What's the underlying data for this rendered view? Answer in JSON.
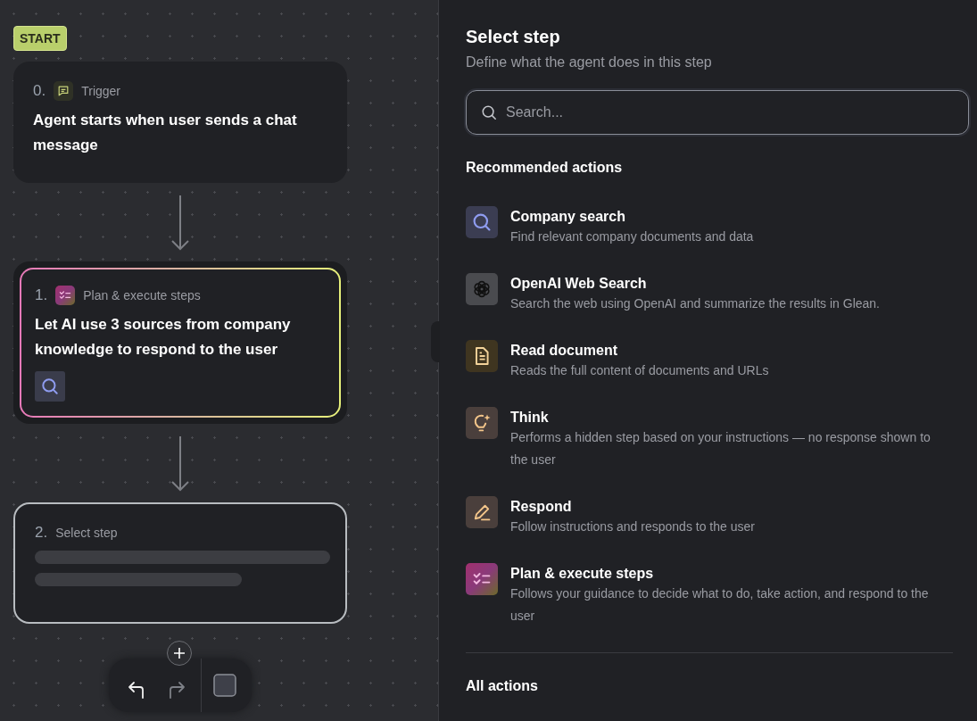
{
  "start_badge": "START",
  "steps": [
    {
      "number": "0.",
      "kind": "trigger",
      "label": "Trigger",
      "text": "Agent starts when user sends a chat message",
      "highlighted": false,
      "selected": false
    },
    {
      "number": "1.",
      "kind": "plan",
      "label": "Plan & execute steps",
      "text": "Let AI use 3 sources from company knowledge to respond to the user",
      "highlighted": true,
      "selected": false,
      "tools": [
        {
          "kind": "search"
        }
      ]
    },
    {
      "number": "2.",
      "kind": "empty",
      "label": "Select step",
      "highlighted": false,
      "selected": true
    }
  ],
  "toolbar": {
    "undo": {
      "disabled": false
    },
    "redo": {
      "disabled": true
    }
  },
  "panel": {
    "title": "Select step",
    "subtitle": "Define what the agent does in this step",
    "search": {
      "placeholder": "Search..."
    },
    "recommended_heading": "Recommended actions",
    "actions": [
      {
        "kind": "search",
        "title": "Company search",
        "description": "Find relevant company documents and data"
      },
      {
        "kind": "knot",
        "title": "OpenAI Web Search",
        "description": "Search the web using OpenAI and summarize the results in Glean."
      },
      {
        "kind": "document",
        "title": "Read document",
        "description": "Reads the full content of documents and URLs"
      },
      {
        "kind": "think",
        "title": "Think",
        "description": "Performs a hidden step based on your instructions — no response shown to the user"
      },
      {
        "kind": "respond",
        "title": "Respond",
        "description": "Follow instructions and responds to the user"
      },
      {
        "kind": "plan",
        "title": "Plan & execute steps",
        "description": "Follows your guidance to decide what to do, take action, and respond to the user"
      }
    ],
    "all_heading": "All actions"
  }
}
